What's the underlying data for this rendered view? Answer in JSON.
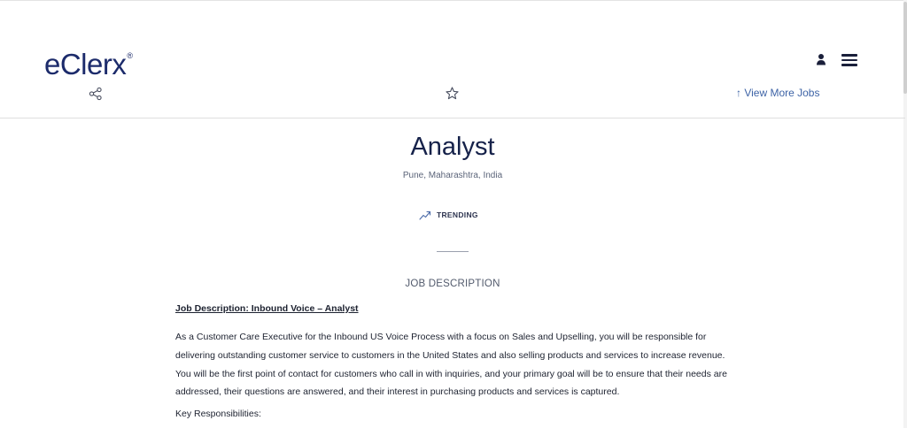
{
  "header": {
    "logo_text": "eClerx",
    "logo_mark": "®",
    "user_icon": "user-icon",
    "menu_icon": "hamburger-menu-icon",
    "share_icon": "share-icon",
    "star_icon": "star-icon",
    "view_more_label": "↑ View More Jobs",
    "brand_color": "#1c2b6b"
  },
  "job": {
    "title": "Analyst",
    "location": "Pune, Maharashtra, India",
    "trending_icon": "trending-up-icon",
    "trending_label": "TRENDING"
  },
  "description": {
    "section_title": "JOB DESCRIPTION",
    "heading": "Job Description: Inbound Voice – Analyst ",
    "paragraph": "As a Customer Care Executive for the Inbound US Voice Process with a focus on Sales and Upselling, you will be responsible for delivering outstanding customer service to customers in the United States and also selling products and services to increase revenue. You will be the first point of contact for customers who call in with inquiries, and your primary goal will be to ensure that their needs are addressed, their questions are answered, and their interest in purchasing products and services is captured.",
    "responsibilities_heading": "Key Responsibilities:"
  }
}
